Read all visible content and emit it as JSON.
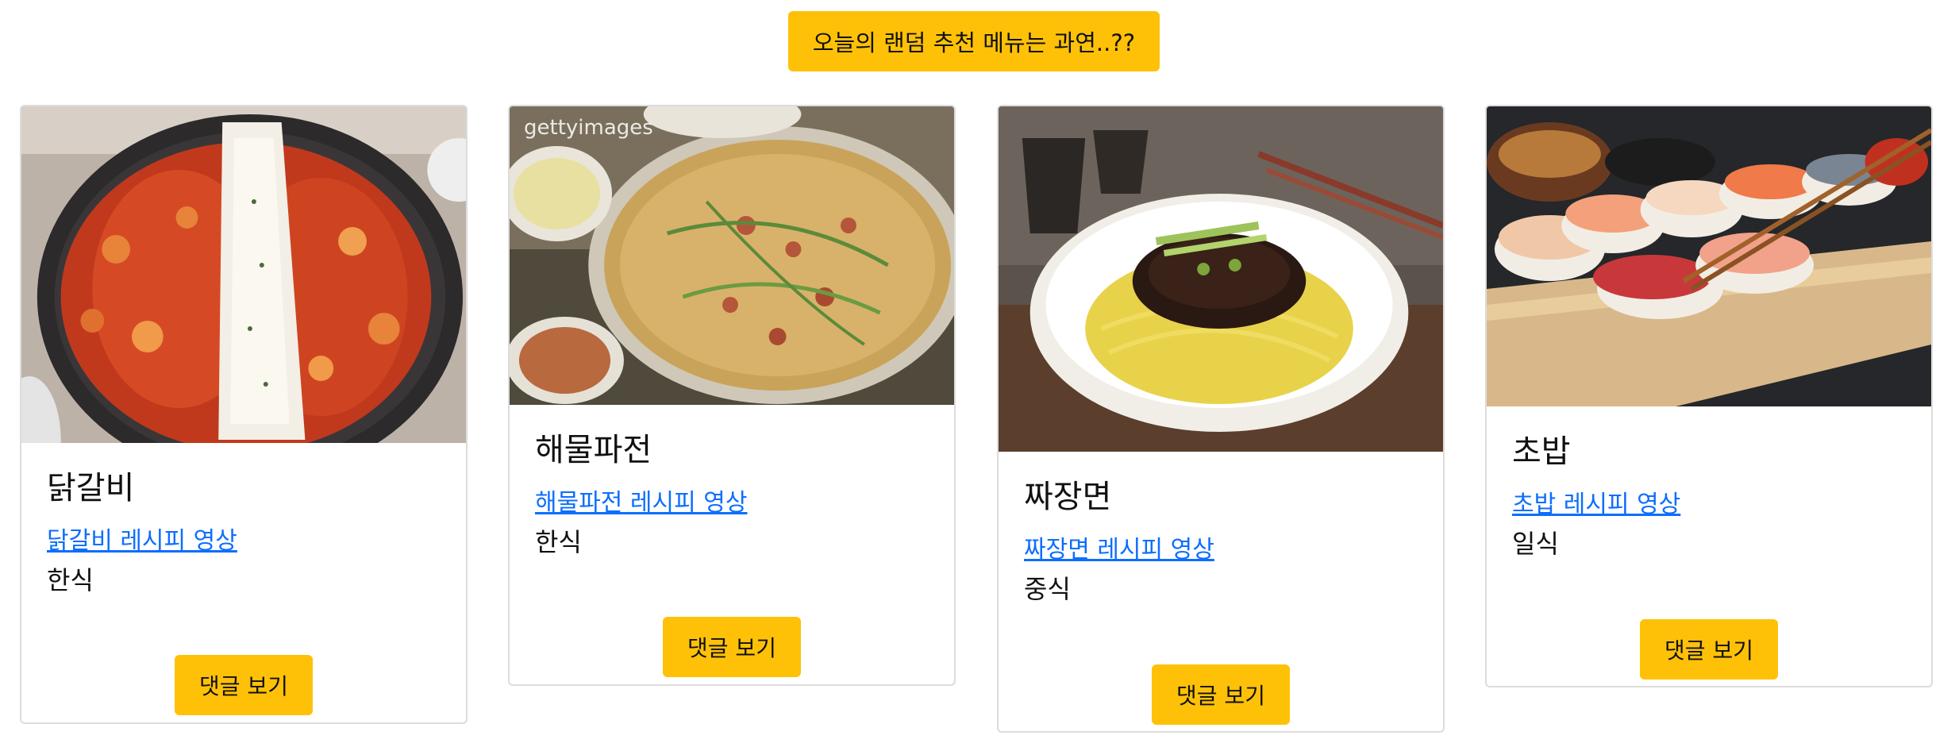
{
  "header": {
    "random_button_label": "오늘의 랜덤 추천 메뉴는 과연..??"
  },
  "cards": [
    {
      "title": "닭갈비",
      "link_text": "닭갈비 레시피 영상",
      "category": "한식",
      "comment_label": "댓글 보기",
      "image_icon": "dakgalbi-photo"
    },
    {
      "title": "해물파전",
      "link_text": "해물파전 레시피 영상",
      "category": "한식",
      "comment_label": "댓글 보기",
      "image_icon": "haemul-pajeon-photo",
      "watermark": "gettyimages"
    },
    {
      "title": "짜장면",
      "link_text": "짜장면 레시피 영상",
      "category": "중식",
      "comment_label": "댓글 보기",
      "image_icon": "jjajangmyeon-photo"
    },
    {
      "title": "초밥",
      "link_text": "초밥 레시피 영상",
      "category": "일식",
      "comment_label": "댓글 보기",
      "image_icon": "sushi-photo"
    }
  ],
  "colors": {
    "button_bg": "#ffc107",
    "link": "#0d6efd",
    "card_border": "#dcdcdc"
  }
}
